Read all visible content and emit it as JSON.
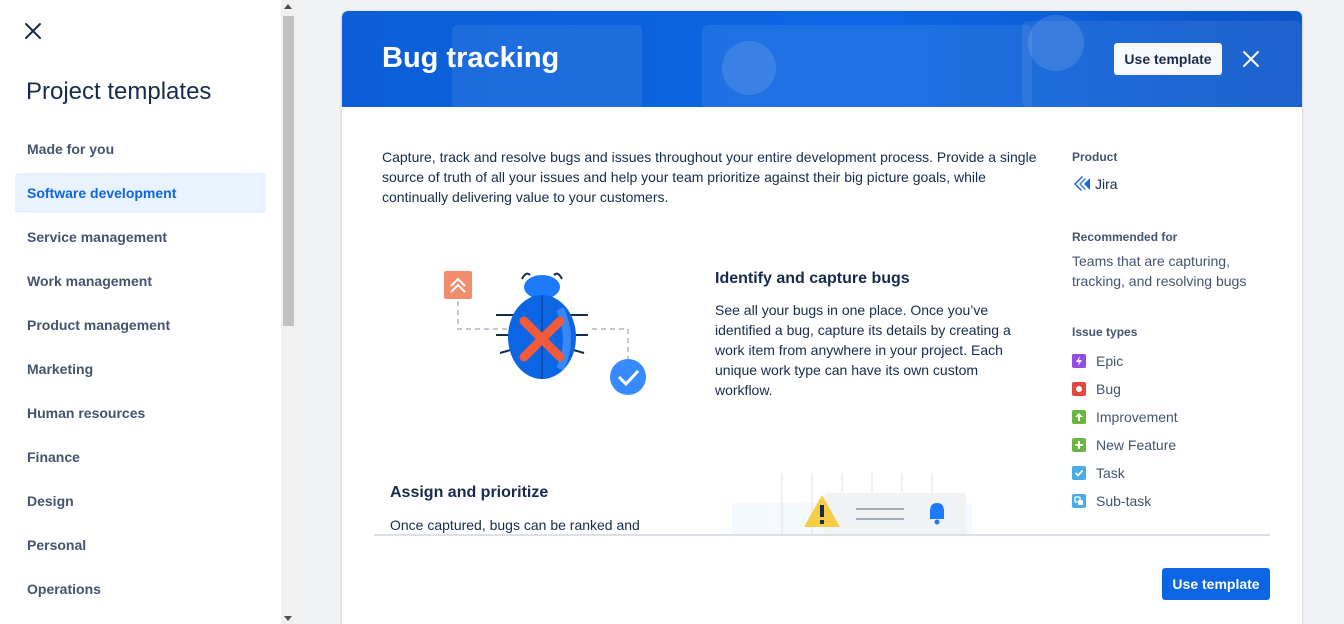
{
  "sidebar": {
    "title": "Project templates",
    "items": [
      {
        "label": "Made for you"
      },
      {
        "label": "Software development",
        "active": true
      },
      {
        "label": "Service management"
      },
      {
        "label": "Work management"
      },
      {
        "label": "Product management"
      },
      {
        "label": "Marketing"
      },
      {
        "label": "Human resources"
      },
      {
        "label": "Finance"
      },
      {
        "label": "Design"
      },
      {
        "label": "Personal"
      },
      {
        "label": "Operations"
      }
    ]
  },
  "modal": {
    "title": "Bug tracking",
    "use_template_top": "Use template",
    "use_template_bottom": "Use template",
    "description": "Capture, track and resolve bugs and issues throughout your entire development process. Provide a single source of truth of all your issues and help your team prioritize against their big picture goals, while continually delivering value to your customers.",
    "features": [
      {
        "title": "Identify and capture bugs",
        "text": "See all your bugs in one place. Once you’ve identified a bug, capture its details by creating a work item from anywhere in your project. Each unique work type can have its own custom workflow."
      },
      {
        "title": "Assign and prioritize",
        "text": "Once captured, bugs can be ranked and"
      }
    ],
    "info": {
      "product_label": "Product",
      "product_name": "Jira",
      "recommended_label": "Recommended for",
      "recommended_text": "Teams that are capturing, tracking, and resolving bugs",
      "issue_types_label": "Issue types",
      "issue_types": [
        {
          "name": "Epic",
          "color": "#904ee2",
          "icon": "lightning-icon"
        },
        {
          "name": "Bug",
          "color": "#e2483d",
          "icon": "bug-dot-icon"
        },
        {
          "name": "Improvement",
          "color": "#6bb643",
          "icon": "arrow-up-icon"
        },
        {
          "name": "New Feature",
          "color": "#6bb643",
          "icon": "plus-icon"
        },
        {
          "name": "Task",
          "color": "#4bade8",
          "icon": "check-icon"
        },
        {
          "name": "Sub-task",
          "color": "#4bade8",
          "icon": "subtask-icon"
        }
      ]
    }
  },
  "colors": {
    "accent": "#0c66e4",
    "active_bg": "#e9f2ff"
  }
}
